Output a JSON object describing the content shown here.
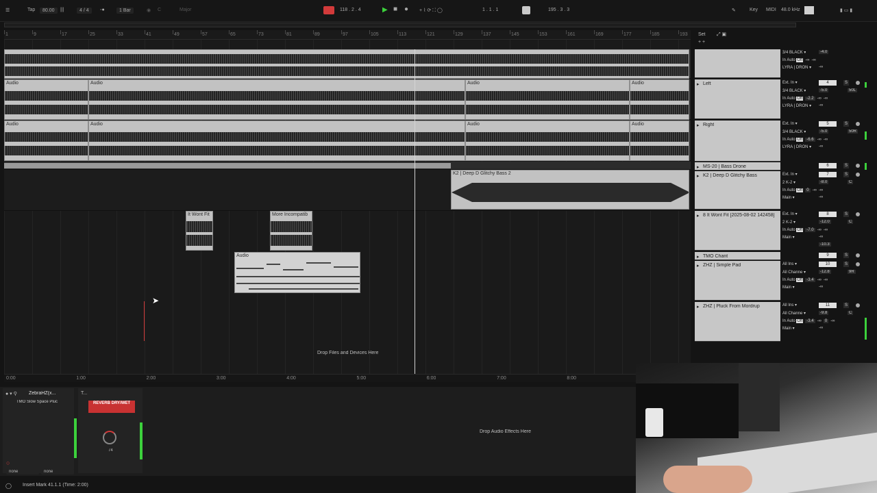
{
  "control_bar": {
    "tap": "Tap",
    "tempo": "80.00",
    "signature": "4 / 4",
    "quantize": "1 Bar",
    "key": "C",
    "scale": "Major",
    "arrangement_pos": "118 . 2 . 4",
    "loop_start": "1 . 1 . 1",
    "loop_length": "195 . 3 . 3",
    "key_label": "Key",
    "midi_label": "MIDI",
    "sample_rate": "48.0 kHz"
  },
  "beat_ruler": [
    "1",
    "9",
    "17",
    "25",
    "33",
    "41",
    "49",
    "57",
    "65",
    "73",
    "81",
    "89",
    "97",
    "105",
    "113",
    "121",
    "129",
    "137",
    "145",
    "153",
    "161",
    "169",
    "177",
    "185",
    "193"
  ],
  "time_ruler": [
    "0:00",
    "1:00",
    "2:00",
    "3:00",
    "4:00",
    "5:00",
    "6:00",
    "7:00",
    "8:00"
  ],
  "clips": {
    "audio": "Audio",
    "bass2": "K2 | Deep D Glitchy Bass 2",
    "wont_fit": "It Wont Fit",
    "incompat": "More Incompatib",
    "audio_midi": "Audio"
  },
  "drop_arrangement": "Drop Files and Devices Here",
  "set_label": "Set",
  "tracks": [
    {
      "name": "",
      "input": "3/4 BLACK",
      "vol": "-4.0",
      "route": "LYRA | DRON",
      "num": ""
    },
    {
      "name": "Left",
      "input": "Ext. In",
      "sub": "3/4 BLACK",
      "num": "4",
      "vol": "-5.0",
      "pan": "50L",
      "vol2": "-2.2",
      "route": "LYRA | DRON"
    },
    {
      "name": "Right",
      "input": "Ext. In",
      "sub": "3/4 BLACK",
      "num": "5",
      "vol": "-5.0",
      "pan": "50R",
      "vol2": "-6.6",
      "route": "LYRA | DRON"
    },
    {
      "name": "MS-20 | Bass Drone",
      "num": "6"
    },
    {
      "name": "K2 | Deep D Glitchy Bass",
      "input": "Ext. In",
      "sub": "2 K-2",
      "num": "7",
      "vol": "-8.0",
      "pan": "C",
      "vol2": "0",
      "route": "Main"
    },
    {
      "name": "8 It Wont Fit [2025-08-02 142458]",
      "input": "Ext. In",
      "sub": "2 K-2",
      "num": "8",
      "vol": "-12.0",
      "pan": "C",
      "vol2": "-7.0",
      "route": "Main",
      "extra": "-10.3"
    },
    {
      "name": "TMO Chant",
      "num": "9"
    },
    {
      "name": "ZHZ | Simple Pad",
      "input": "All Ins",
      "sub": "All Channe",
      "num": "10",
      "vol": "-12.8",
      "pan": "9R",
      "vol2": "-3.4",
      "route": "Main"
    },
    {
      "name": "ZHZ | Pluck From Mordrup",
      "input": "All Ins",
      "sub": "All Channe",
      "num": "11",
      "vol": "-9.8",
      "pan": "C",
      "vol2": "-3.4",
      "vol3": "0",
      "route": "Main"
    }
  ],
  "mix_labels": {
    "in": "In",
    "auto": "Auto",
    "off": "Off",
    "solo": "S",
    "inf": "-∞"
  },
  "device": {
    "rack_name": "ZebraHZ(x...",
    "chain_name": "TMO Slow Space Pluc",
    "in_select": "none",
    "out_select": "none",
    "macro_title": "T...",
    "macro_label": "REVERB DRY/WET",
    "knob_value": "74",
    "drop_effects": "Drop Audio Effects Here"
  },
  "status_text": "Insert Mark 41.1.1 (Time: 2:00)",
  "colors": {
    "accent": "#d23a3a",
    "clip": "#c2c2c2",
    "meter": "#3cd13c"
  }
}
